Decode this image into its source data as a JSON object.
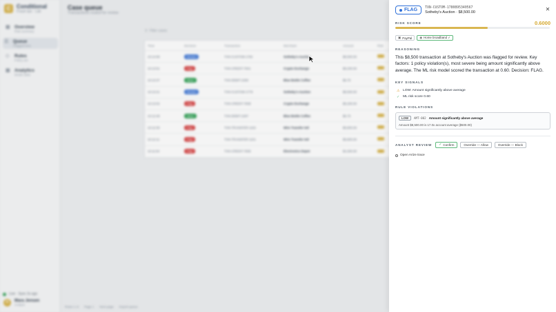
{
  "app": {
    "brand_name": "Conditional",
    "brand_sub": "Fraud ops · Lab",
    "nav": [
      {
        "label": "Overview",
        "sub": "Risk summary",
        "icon": "dashboard-icon"
      },
      {
        "label": "Queue",
        "sub": "Flagged txns",
        "icon": "queue-icon"
      },
      {
        "label": "Rules",
        "sub": "Policy set",
        "icon": "rules-icon"
      },
      {
        "label": "Analytics",
        "sub": "Model stats",
        "icon": "chart-icon"
      }
    ],
    "status": "Live · Sync 2s ago",
    "user_initial": "M",
    "user_name": "Mara Jensen",
    "user_role": "Analyst"
  },
  "main": {
    "title": "Case queue",
    "subtitle": "Transactions routed for review",
    "search_placeholder": "Filter cases",
    "columns": [
      "Time",
      "Decision",
      "Transaction",
      "Merchant",
      "Amount",
      "Risk"
    ],
    "rows": [
      {
        "time": "10:14:08",
        "decision": "Review",
        "txn": "TXN-CUSTOM-1782",
        "merchant": "Sotheby's Auction",
        "amount": "$8,500.00",
        "d": "review"
      },
      {
        "time": "10:13:51",
        "decision": "Flag",
        "txn": "TXN-CREDIT-7841",
        "merchant": "Crypto Exchange",
        "amount": "$9,200.00",
        "d": "flag"
      },
      {
        "time": "10:13:37",
        "decision": "Allow",
        "txn": "TXN-DEBIT-2290",
        "merchant": "Blue Bottle Coffee",
        "amount": "$6.75",
        "d": "allow"
      },
      {
        "time": "10:13:21",
        "decision": "Review",
        "txn": "TXN-CUSTOM-1779",
        "merchant": "Sotheby's Auction",
        "amount": "$8,500.00",
        "d": "review"
      },
      {
        "time": "10:13:02",
        "decision": "Flag",
        "txn": "TXN-CREDIT-7838",
        "merchant": "Crypto Exchange",
        "amount": "$9,200.00",
        "d": "flag"
      },
      {
        "time": "10:12:48",
        "decision": "Allow",
        "txn": "TXN-DEBIT-2287",
        "merchant": "Blue Bottle Coffee",
        "amount": "$6.75",
        "d": "allow"
      },
      {
        "time": "10:12:30",
        "decision": "Flag",
        "txn": "TXN-TRANSFER-1102",
        "merchant": "Wire Transfer Intl",
        "amount": "$9,800.00",
        "d": "flag"
      },
      {
        "time": "10:12:11",
        "decision": "Flag",
        "txn": "TXN-TRANSFER-1101",
        "merchant": "Wire Transfer Intl",
        "amount": "$9,800.00",
        "d": "flag"
      },
      {
        "time": "10:11:54",
        "decision": "Flag",
        "txn": "TXN-CREDIT-7835",
        "merchant": "Electronics Depot",
        "amount": "$4,300.00",
        "d": "flag"
      }
    ],
    "pager": [
      "Rows 1–9",
      "Page 1",
      "Next page",
      "Export queue"
    ]
  },
  "drawer": {
    "decision": "FLAG",
    "txn_id": "TXN-CUSTOM-1780895340567",
    "merchant_amount": "Sotheby's Auction · $8,500.00",
    "risk_label": "Risk score",
    "risk_value": "0.6000",
    "risk_fraction": 0.6,
    "tags": [
      "PayPal",
      "Home broadband ✓"
    ],
    "reasoning_label": "Reasoning",
    "reasoning": "This $8,500 transaction at Sotheby's Auction was flagged for review. Key factors: 1 policy violation(s), most severe being amount significantly above average. The ML risk model scored the transaction at 0.60. Decision: FLAG.",
    "signals_label": "Key signals",
    "signals": [
      "LOW: Amount significantly above average",
      "ML risk score 0.60"
    ],
    "violations_label": "Rule violations",
    "violation": {
      "severity": "LOW",
      "code": "AMT-002",
      "title": "Amount significantly above average",
      "detail": "Amount $8,500.00 is 17.0x account average ($500.00)"
    },
    "review_label": "Analyst review",
    "buttons": {
      "confirm": "Confirm",
      "allow": "Override — Allow",
      "block": "Override — Block"
    },
    "trace_link": "Open Arize trace",
    "colors": {
      "accent": "#2e6fd8",
      "risk": "#d9b650",
      "ok": "#3aa55d"
    }
  }
}
